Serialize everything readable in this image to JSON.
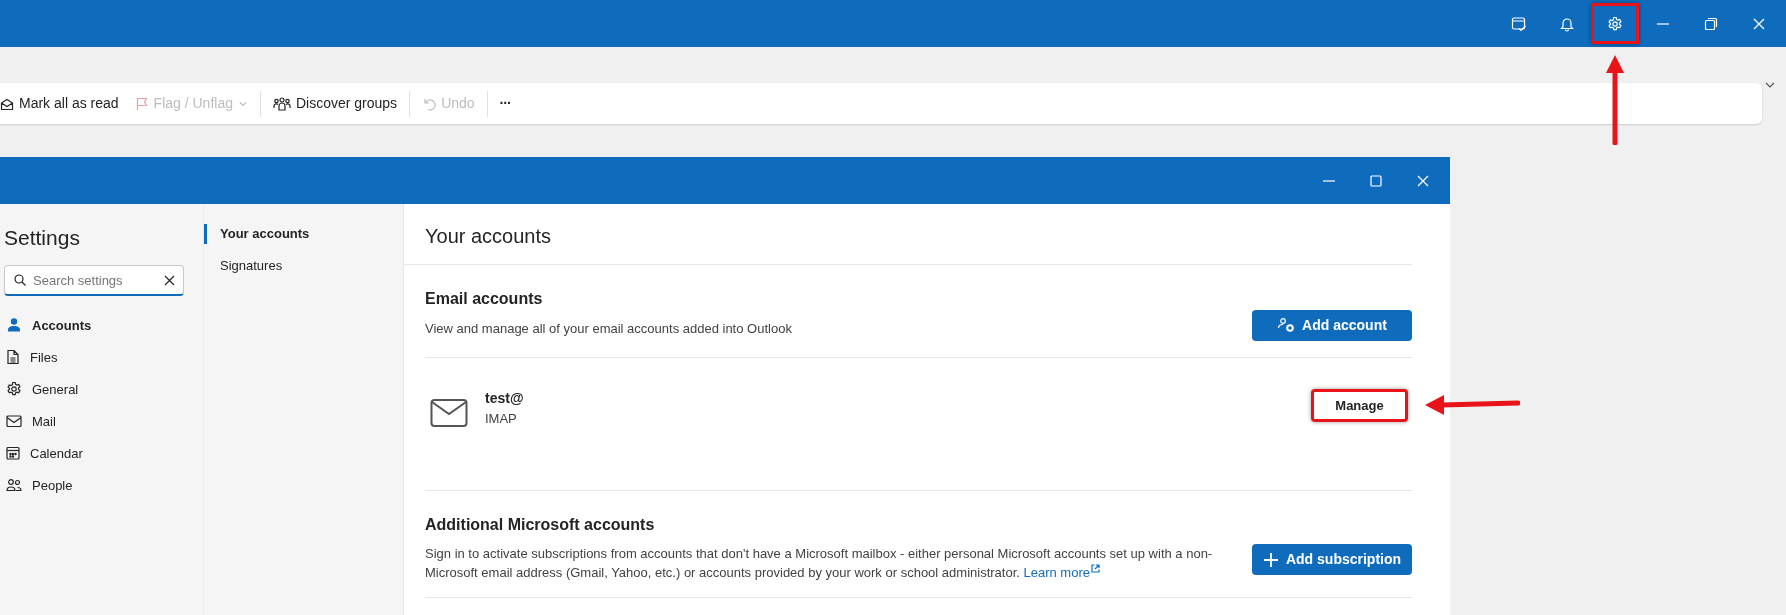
{
  "title_bar": {
    "buttons": [
      {
        "kind": "tasks",
        "highlighted": false
      },
      {
        "kind": "bell",
        "highlighted": false
      },
      {
        "kind": "settings",
        "highlighted": true
      },
      {
        "kind": "minimize",
        "highlighted": false
      },
      {
        "kind": "restore",
        "highlighted": false
      },
      {
        "kind": "close",
        "highlighted": false
      }
    ]
  },
  "toolbar": {
    "items": [
      {
        "kind": "button",
        "label": "Mark all as read",
        "disabled": false,
        "dropdown": false
      },
      {
        "kind": "button",
        "label": "Flag / Unflag",
        "disabled": true,
        "dropdown": true
      },
      {
        "kind": "separator"
      },
      {
        "kind": "button",
        "label": "Discover groups",
        "disabled": false,
        "dropdown": false
      },
      {
        "kind": "separator"
      },
      {
        "kind": "button",
        "label": "Undo",
        "disabled": true,
        "dropdown": false
      },
      {
        "kind": "separator"
      },
      {
        "kind": "more",
        "label": "···",
        "disabled": false,
        "dropdown": false
      }
    ]
  },
  "settings_dialog": {
    "title": "Settings",
    "search": {
      "placeholder": "Search settings"
    },
    "categories": [
      {
        "label": "Accounts",
        "selected": true
      },
      {
        "label": "Files",
        "selected": false
      },
      {
        "label": "General",
        "selected": false
      },
      {
        "label": "Mail",
        "selected": false
      },
      {
        "label": "Calendar",
        "selected": false
      },
      {
        "label": "People",
        "selected": false
      }
    ],
    "subpages": [
      {
        "label": "Your accounts",
        "selected": true
      },
      {
        "label": "Signatures",
        "selected": false
      }
    ],
    "page_title": "Your accounts",
    "sections": [
      {
        "heading": "Email accounts",
        "description": "View and manage all of your email accounts added into Outlook",
        "action": "Add account",
        "accounts": [
          {
            "name": "test@",
            "type": "IMAP",
            "action": "Manage",
            "highlighted": true
          }
        ]
      },
      {
        "heading": "Additional Microsoft accounts",
        "description": "Sign in to activate subscriptions from accounts that don't have a Microsoft mailbox - either personal Microsoft accounts set up with a non-Microsoft email address (Gmail, Yahoo, etc.) or accounts provided by your work or school administrator.",
        "link": "Learn more",
        "action": "Add subscription"
      }
    ]
  }
}
